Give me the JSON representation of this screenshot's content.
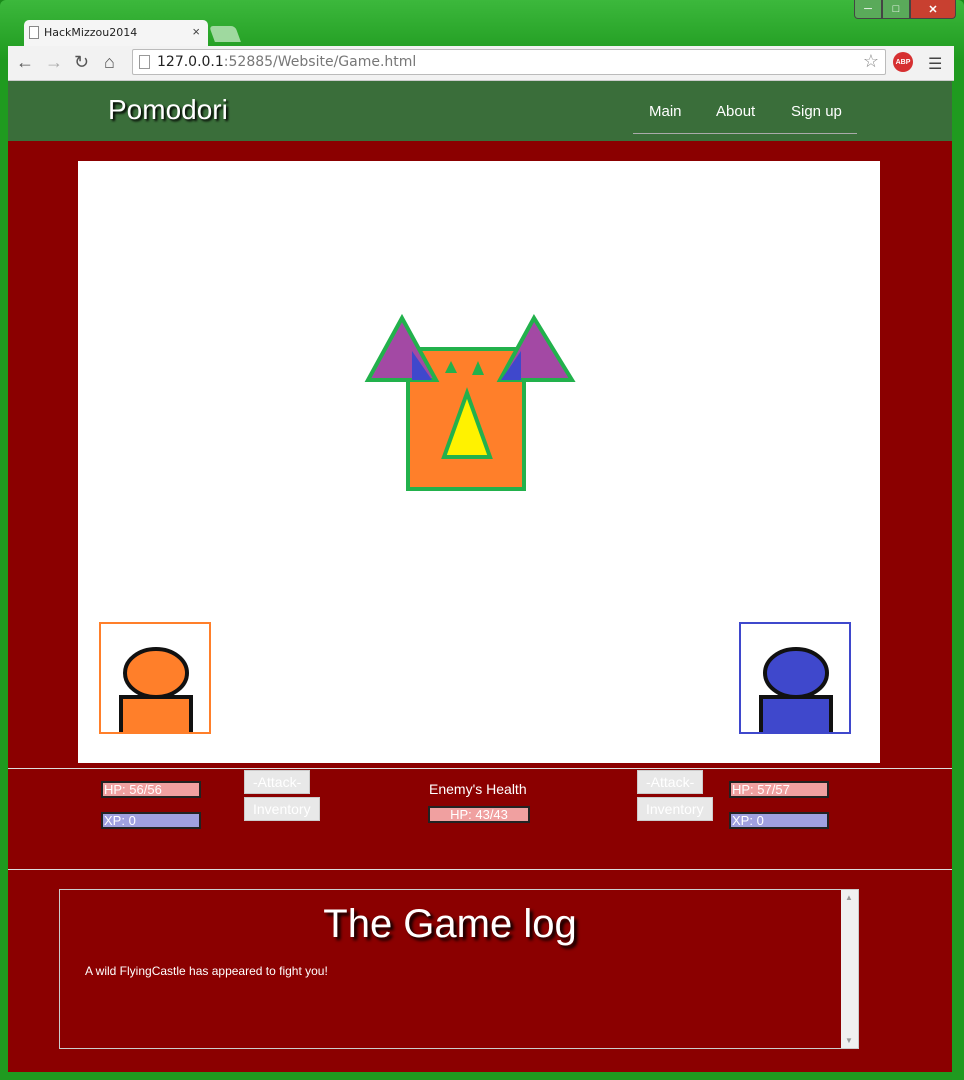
{
  "browser": {
    "tab_title": "HackMizzou2014",
    "tab_close": "×",
    "url_host": "127.0.0.1",
    "url_rest": ":52885/Website/Game.html",
    "abp_label": "ABP"
  },
  "site": {
    "brand": "Pomodori",
    "nav": [
      "Main",
      "About",
      "Sign up"
    ]
  },
  "game": {
    "player1": {
      "hp": "HP: 56/56",
      "xp": "XP: 0",
      "attack": "-Attack-",
      "inventory": "Inventory",
      "color": "#ff7f2a"
    },
    "player2": {
      "hp": "HP: 57/57",
      "xp": "XP: 0",
      "attack": "-Attack-",
      "inventory": "Inventory",
      "color": "#3f48cc"
    },
    "enemy": {
      "label": "Enemy's Health",
      "hp": "HP: 43/43",
      "name": "FlyingCastle"
    }
  },
  "log": {
    "title": "The Game log",
    "entries": [
      "A wild FlyingCastle has appeared to fight you!"
    ]
  },
  "colors": {
    "page_bg": "#8b0000",
    "navbar": "#3a6e3a",
    "enemy_outline": "#22b14c"
  }
}
